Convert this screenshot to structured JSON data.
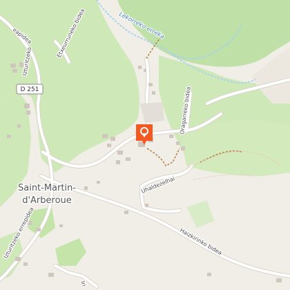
{
  "map": {
    "labels": {
      "town_line1": "Saint-Martin-",
      "town_line2": "d'Arberoue",
      "road_shield": "D 251",
      "stream": "Lekorreko erreka",
      "road_top_left": "eapidea",
      "road_iztur_upper": "Izturitzeko",
      "road_etxe": "Etxeurruneko bidea",
      "road_oragarreko": "Oragarreko bidea",
      "road_uhaldezelhai": "Uhaldezelhai",
      "road_iztur_lower": "Izturitzeko errepidea",
      "road_haizkirinko": "Haizkirinko bidea",
      "road_bottom": "Iri"
    },
    "colors": {
      "background": "#f1eee8",
      "forest": "#cfe8b8",
      "forest_dark": "#bfe0a6",
      "road": "#ffffff",
      "road_casing": "#d9d4cc",
      "building": "#cfc7bd",
      "path": "#b58a46",
      "water": "#a9d2ec",
      "marker": "#f25a22"
    },
    "marker": {
      "icon": "map-pin-icon"
    }
  }
}
